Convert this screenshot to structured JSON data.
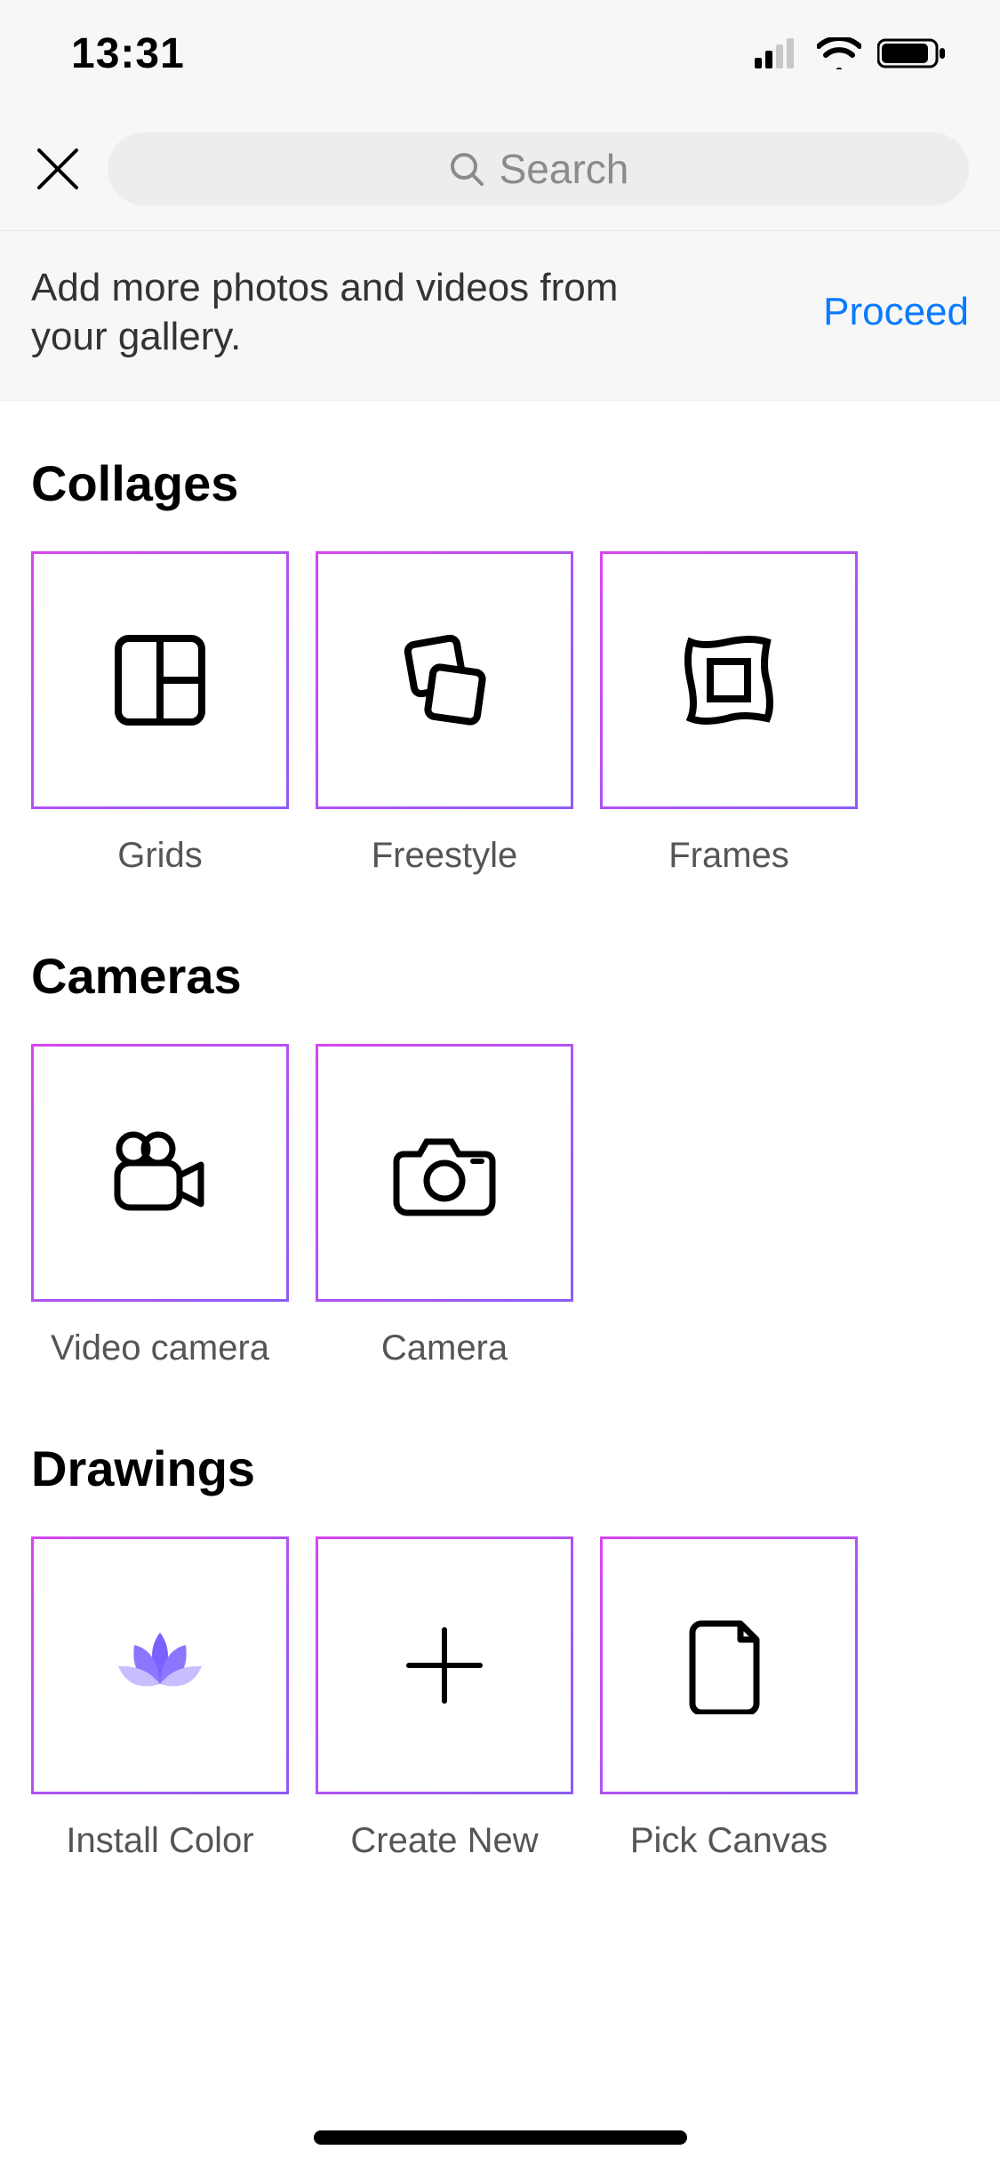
{
  "status": {
    "time": "13:31"
  },
  "search": {
    "placeholder": "Search"
  },
  "banner": {
    "text": "Add more photos and videos from your gallery.",
    "cta": "Proceed"
  },
  "sections": {
    "collages": {
      "title": "Collages",
      "items": [
        {
          "label": "Grids"
        },
        {
          "label": "Freestyle"
        },
        {
          "label": "Frames"
        }
      ]
    },
    "cameras": {
      "title": "Cameras",
      "items": [
        {
          "label": "Video camera"
        },
        {
          "label": "Camera"
        }
      ]
    },
    "drawings": {
      "title": "Drawings",
      "items": [
        {
          "label": "Install Color"
        },
        {
          "label": "Create New"
        },
        {
          "label": "Pick Canvas"
        }
      ]
    }
  }
}
